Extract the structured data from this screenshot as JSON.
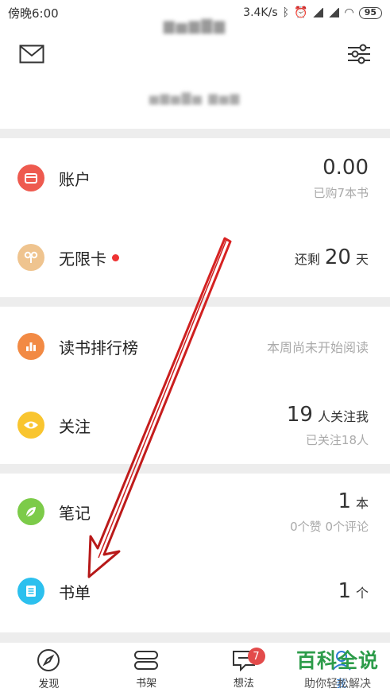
{
  "status_bar": {
    "time": "傍晚6:00",
    "speed": "3.4K/s",
    "battery": "95"
  },
  "rows": {
    "account": {
      "label": "账户",
      "value": "0.00",
      "sub": "已购7本书"
    },
    "unlimited": {
      "label": "无限卡",
      "prefix": "还剩",
      "value": "20",
      "unit": "天"
    },
    "ranking": {
      "label": "读书排行榜",
      "status": "本周尚未开始阅读"
    },
    "follow": {
      "label": "关注",
      "value": "19",
      "unit": "人关注我",
      "sub": "已关注18人"
    },
    "notes": {
      "label": "笔记",
      "value": "1",
      "unit": "本",
      "sub": "0个赞 0个评论"
    },
    "booklist": {
      "label": "书单",
      "value": "1",
      "unit": "个"
    }
  },
  "tabs": [
    {
      "label": "发现"
    },
    {
      "label": "书架"
    },
    {
      "label": "想法",
      "badge": "7"
    },
    {
      "label": "我"
    }
  ],
  "watermark": {
    "title": "百科全说",
    "subtitle": "助你轻松解决"
  },
  "colors": {
    "account_icon": "#ee5a4f",
    "unlimited_icon": "#efc48f",
    "ranking_icon": "#f28a44",
    "follow_icon": "#f9c52f",
    "notes_icon": "#7ccb49",
    "booklist_icon": "#2cc0ee",
    "annotation_arrow": "#cc1f1f"
  }
}
